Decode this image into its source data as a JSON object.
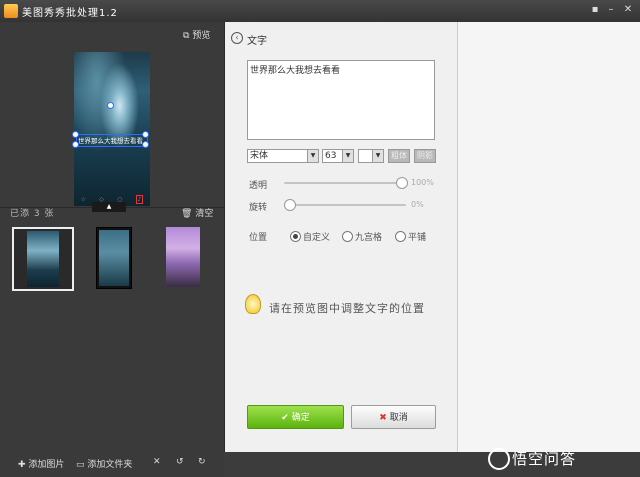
{
  "window": {
    "title": "美图秀秀批处理1.2",
    "controls": [
      "chat-icon",
      "minimize-icon",
      "close-icon"
    ]
  },
  "left": {
    "preview_label": "预览",
    "overlay_text": "世界那么大我想去看看",
    "added_text": "已添 3 张",
    "clear_label": "清空",
    "thumbnails": 3,
    "add_image_label": "添加图片",
    "add_folder_label": "添加文件夹"
  },
  "text_panel": {
    "title": "文字",
    "content": "世界那么大我想去看看",
    "font": "宋体",
    "size": "63",
    "bold_label": "粗体",
    "shadow_label": "阴影",
    "opacity_label": "透明",
    "opacity_value": "100%",
    "opacity_pct": 100,
    "rotate_label": "旋转",
    "rotate_value": "0%",
    "rotate_pct": 0,
    "position_label": "位置",
    "position_options": [
      "自定义",
      "九宫格",
      "平铺"
    ],
    "position_selected": "自定义",
    "tip": "请在预览图中调整文字的位置",
    "ok_label": "确定",
    "cancel_label": "取消"
  },
  "watermark": "悟空问答",
  "colors": {
    "dark_bg": "#3a3a3a",
    "panel_bg": "#f0f0f0",
    "ok_green": "#6cc01a"
  }
}
